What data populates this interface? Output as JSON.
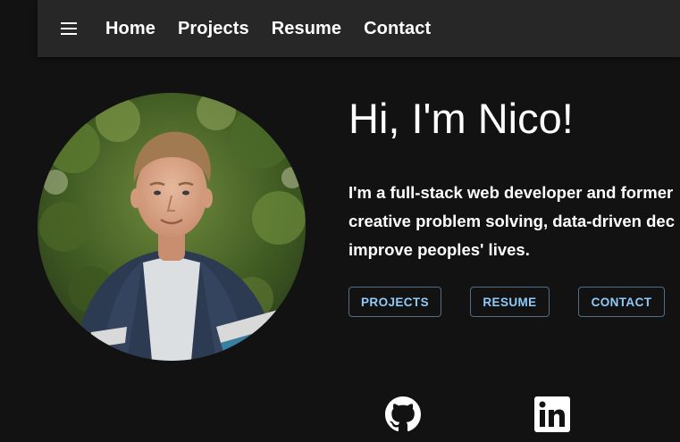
{
  "nav": {
    "menu_icon": "hamburger-menu-icon",
    "links": [
      {
        "label": "Home"
      },
      {
        "label": "Projects"
      },
      {
        "label": "Resume"
      },
      {
        "label": "Contact"
      }
    ]
  },
  "hero": {
    "title": "Hi, I'm Nico!",
    "description_lines": [
      "I'm a full-stack web developer and former",
      "creative problem solving, data-driven dec",
      "improve peoples' lives."
    ],
    "buttons": [
      {
        "label": "PROJECTS"
      },
      {
        "label": "RESUME"
      },
      {
        "label": "CONTACT"
      }
    ]
  },
  "social": {
    "icons": [
      "github-icon",
      "linkedin-icon"
    ]
  },
  "colors": {
    "background": "#121212",
    "navbar": "#272727",
    "accent": "#90caf9",
    "text": "#ffffff"
  }
}
